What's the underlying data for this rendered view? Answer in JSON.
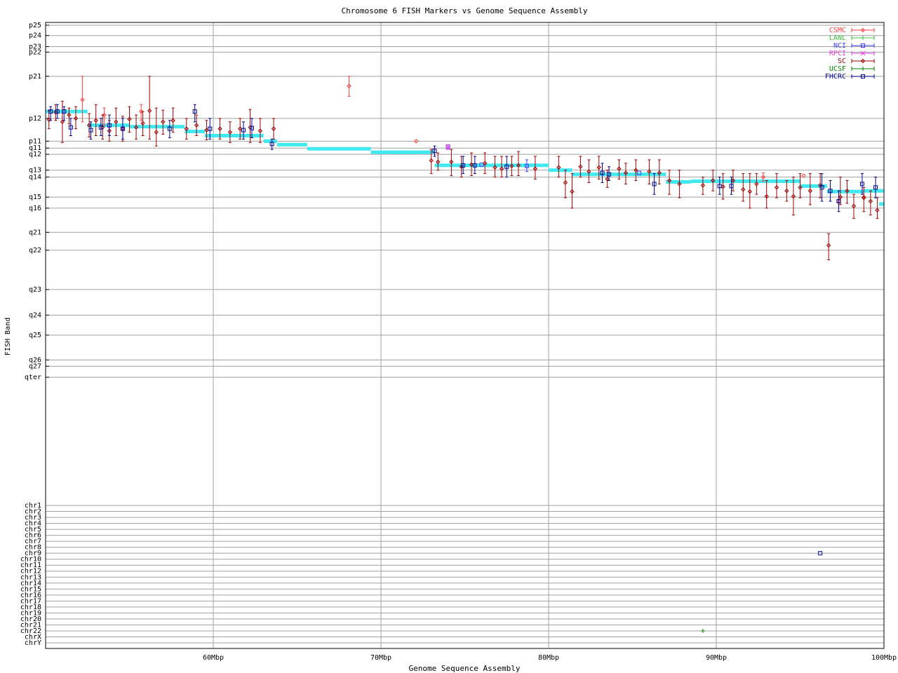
{
  "chart_data": {
    "type": "scatter",
    "title": "Chromosome 6 FISH Markers vs Genome Sequence Assembly",
    "xlabel": "Genome Sequence Assembly",
    "ylabel": "FISH Band",
    "xlim": [
      50,
      100
    ],
    "x_unit": "Mbp",
    "x_ticks": [
      60,
      70,
      80,
      90,
      100
    ],
    "x_tick_labels": [
      "60Mbp",
      "70Mbp",
      "80Mbp",
      "90Mbp",
      "100Mbp"
    ],
    "grid": true,
    "legend_position": "top-right",
    "band_axis": [
      {
        "label": "p25",
        "v": 0
      },
      {
        "label": "p24",
        "v": 1.5
      },
      {
        "label": "p23",
        "v": 3.1
      },
      {
        "label": "p22",
        "v": 3.9
      },
      {
        "label": "p21",
        "v": 7.4
      },
      {
        "label": "p12",
        "v": 13.5
      },
      {
        "label": "p11",
        "v": 16.8
      },
      {
        "label": "q11",
        "v": 17.8
      },
      {
        "label": "q12",
        "v": 18.7
      },
      {
        "label": "q13",
        "v": 21.0
      },
      {
        "label": "q14",
        "v": 22.0
      },
      {
        "label": "q15",
        "v": 24.9
      },
      {
        "label": "q16",
        "v": 26.5
      },
      {
        "label": "q21",
        "v": 30.0
      },
      {
        "label": "q22",
        "v": 32.6
      },
      {
        "label": "q23",
        "v": 38.3
      },
      {
        "label": "q24",
        "v": 42.0
      },
      {
        "label": "q25",
        "v": 44.9
      },
      {
        "label": "q26",
        "v": 48.5
      },
      {
        "label": "q27",
        "v": 49.4
      },
      {
        "label": "qter",
        "v": 51.0
      }
    ],
    "band_range": [
      -0.2,
      51.6
    ],
    "chromosome_axis": [
      "chr1",
      "chr2",
      "chr3",
      "chr4",
      "chr5",
      "chr6",
      "chr7",
      "chr8",
      "chr9",
      "chr10",
      "chr11",
      "chr12",
      "chr13",
      "chr14",
      "chr15",
      "chr16",
      "chr17",
      "chr18",
      "chr19",
      "chr20",
      "chr21",
      "chr22",
      "chrX",
      "chrY"
    ],
    "series": [
      {
        "name": "CSMC",
        "color": "#ff4040",
        "marker": "diamond",
        "points": [
          {
            "x": 52.2,
            "y": 10.8,
            "lo": 7.4,
            "hi": 14.0
          },
          {
            "x": 53.5,
            "y": 13.0,
            "lo": 12.0,
            "hi": 14.5
          },
          {
            "x": 55.7,
            "y": 12.5,
            "lo": 11.5,
            "hi": 13.8
          },
          {
            "x": 68.1,
            "y": 8.8,
            "lo": 7.4,
            "hi": 10.3
          },
          {
            "x": 72.1,
            "y": 16.8
          },
          {
            "x": 92.8,
            "y": 22.0,
            "lo": 21.4,
            "hi": 22.6
          },
          {
            "x": 95.2,
            "y": 21.8
          },
          {
            "x": 97.3,
            "y": 25.5
          },
          {
            "x": 98.8,
            "y": 24.9
          }
        ]
      },
      {
        "name": "LANL",
        "color": "#40c040",
        "marker": "plus",
        "points": []
      },
      {
        "name": "NCI",
        "color": "#4040ff",
        "marker": "square",
        "points": [
          {
            "x": 74.0,
            "y": 17.6
          },
          {
            "x": 76.0,
            "y": 20.2
          },
          {
            "x": 78.7,
            "y": 20.4,
            "lo": 19.5,
            "hi": 21.2
          },
          {
            "x": 85.4,
            "y": 21.4
          }
        ]
      },
      {
        "name": "RPCI",
        "color": "#e040e0",
        "marker": "cross",
        "points": [
          {
            "x": 74.0,
            "y": 17.7,
            "lo": 17.3,
            "hi": 18.0
          }
        ]
      },
      {
        "name": "SC",
        "color": "#a00000",
        "marker": "diamond",
        "points": [
          {
            "x": 50.2,
            "y": 13.7,
            "lo": 12.4,
            "hi": 15.0
          },
          {
            "x": 50.6,
            "y": 12.6,
            "lo": 11.5,
            "hi": 13.8
          },
          {
            "x": 51.0,
            "y": 14.0,
            "lo": 11.0,
            "hi": 17.0
          },
          {
            "x": 51.4,
            "y": 13.0,
            "lo": 12.0,
            "hi": 14.3
          },
          {
            "x": 51.8,
            "y": 13.5,
            "lo": 11.8,
            "hi": 15.0
          },
          {
            "x": 52.6,
            "y": 14.5,
            "lo": 12.8,
            "hi": 16.2
          },
          {
            "x": 53.0,
            "y": 13.8,
            "lo": 11.5,
            "hi": 16.0
          },
          {
            "x": 53.4,
            "y": 14.8,
            "lo": 13.0,
            "hi": 16.5
          },
          {
            "x": 53.8,
            "y": 15.3,
            "lo": 13.8,
            "hi": 16.8
          },
          {
            "x": 54.2,
            "y": 14.0,
            "lo": 12.0,
            "hi": 16.0
          },
          {
            "x": 54.6,
            "y": 15.0,
            "lo": 13.2,
            "hi": 16.8
          },
          {
            "x": 55.0,
            "y": 13.6,
            "lo": 11.8,
            "hi": 15.5
          },
          {
            "x": 55.4,
            "y": 14.8,
            "lo": 13.0,
            "hi": 16.5
          },
          {
            "x": 55.8,
            "y": 14.2,
            "lo": 12.5,
            "hi": 16.0
          },
          {
            "x": 56.2,
            "y": 12.4,
            "lo": 7.4,
            "hi": 16.5
          },
          {
            "x": 56.6,
            "y": 15.5,
            "lo": 12.0,
            "hi": 17.5
          },
          {
            "x": 57.0,
            "y": 14.0,
            "lo": 12.3,
            "hi": 15.8
          },
          {
            "x": 57.6,
            "y": 13.8,
            "lo": 12.0,
            "hi": 15.5
          },
          {
            "x": 58.4,
            "y": 15.0,
            "lo": 13.5,
            "hi": 16.5
          },
          {
            "x": 59.0,
            "y": 14.5,
            "lo": 13.0,
            "hi": 16.0
          },
          {
            "x": 59.6,
            "y": 15.2,
            "lo": 13.8,
            "hi": 16.6
          },
          {
            "x": 60.4,
            "y": 15.0,
            "lo": 13.5,
            "hi": 16.5
          },
          {
            "x": 61.0,
            "y": 15.5,
            "lo": 14.0,
            "hi": 17.0
          },
          {
            "x": 61.6,
            "y": 15.0,
            "lo": 13.5,
            "hi": 16.5
          },
          {
            "x": 62.2,
            "y": 14.8,
            "lo": 12.2,
            "hi": 17.0
          },
          {
            "x": 62.8,
            "y": 15.3,
            "lo": 13.5,
            "hi": 17.0
          },
          {
            "x": 63.6,
            "y": 15.0,
            "lo": 13.5,
            "hi": 16.5
          },
          {
            "x": 73.0,
            "y": 19.6,
            "lo": 18.0,
            "hi": 21.5
          },
          {
            "x": 73.4,
            "y": 19.8,
            "lo": 18.5,
            "hi": 21.0
          },
          {
            "x": 74.2,
            "y": 19.8,
            "lo": 18.0,
            "hi": 21.8
          },
          {
            "x": 74.8,
            "y": 20.5,
            "lo": 19.0,
            "hi": 22.0
          },
          {
            "x": 75.4,
            "y": 20.2,
            "lo": 18.5,
            "hi": 21.8
          },
          {
            "x": 76.2,
            "y": 20.0,
            "lo": 18.5,
            "hi": 21.5
          },
          {
            "x": 76.8,
            "y": 20.6,
            "lo": 19.0,
            "hi": 22.0
          },
          {
            "x": 77.2,
            "y": 20.8,
            "lo": 19.0,
            "hi": 22.0
          },
          {
            "x": 77.8,
            "y": 20.4,
            "lo": 19.0,
            "hi": 21.8
          },
          {
            "x": 78.2,
            "y": 20.3,
            "lo": 18.3,
            "hi": 21.8
          },
          {
            "x": 79.2,
            "y": 20.8,
            "lo": 19.0,
            "hi": 22.3
          },
          {
            "x": 80.6,
            "y": 20.6,
            "lo": 19.0,
            "hi": 22.0
          },
          {
            "x": 81.0,
            "y": 22.8,
            "lo": 21.0,
            "hi": 25.0
          },
          {
            "x": 81.4,
            "y": 24.1,
            "lo": 21.5,
            "hi": 26.5
          },
          {
            "x": 81.9,
            "y": 20.5,
            "lo": 19.0,
            "hi": 22.0
          },
          {
            "x": 82.4,
            "y": 21.2,
            "lo": 19.5,
            "hi": 22.8
          },
          {
            "x": 83.0,
            "y": 20.6,
            "lo": 19.0,
            "hi": 22.3
          },
          {
            "x": 83.5,
            "y": 22.3,
            "lo": 21.0,
            "hi": 23.5
          },
          {
            "x": 84.2,
            "y": 20.8,
            "lo": 19.5,
            "hi": 22.3
          },
          {
            "x": 84.6,
            "y": 21.4,
            "lo": 20.0,
            "hi": 23.0
          },
          {
            "x": 85.2,
            "y": 21.0,
            "lo": 19.5,
            "hi": 22.5
          },
          {
            "x": 86.0,
            "y": 21.2,
            "lo": 19.5,
            "hi": 23.0
          },
          {
            "x": 86.6,
            "y": 21.4,
            "lo": 19.5,
            "hi": 23.0
          },
          {
            "x": 87.2,
            "y": 22.5,
            "lo": 21.0,
            "hi": 24.5
          },
          {
            "x": 87.8,
            "y": 23.0,
            "lo": 21.0,
            "hi": 25.0
          },
          {
            "x": 89.2,
            "y": 23.2,
            "lo": 22.0,
            "hi": 24.5
          },
          {
            "x": 89.8,
            "y": 22.5,
            "lo": 21.0,
            "hi": 24.0
          },
          {
            "x": 90.4,
            "y": 23.4,
            "lo": 21.5,
            "hi": 25.2
          },
          {
            "x": 91.0,
            "y": 22.5,
            "lo": 21.0,
            "hi": 24.0
          },
          {
            "x": 91.6,
            "y": 23.8,
            "lo": 21.5,
            "hi": 25.5
          },
          {
            "x": 92.0,
            "y": 24.1,
            "lo": 21.5,
            "hi": 26.5
          },
          {
            "x": 92.4,
            "y": 23.0,
            "lo": 21.5,
            "hi": 24.5
          },
          {
            "x": 93.0,
            "y": 24.8,
            "lo": 22.5,
            "hi": 26.5
          },
          {
            "x": 93.6,
            "y": 23.5,
            "lo": 21.5,
            "hi": 25.0
          },
          {
            "x": 94.2,
            "y": 24.0,
            "lo": 22.5,
            "hi": 25.5
          },
          {
            "x": 94.6,
            "y": 24.8,
            "lo": 22.0,
            "hi": 27.5
          },
          {
            "x": 95.0,
            "y": 23.5,
            "lo": 21.5,
            "hi": 25.0
          },
          {
            "x": 95.6,
            "y": 24.0,
            "lo": 21.5,
            "hi": 26.0
          },
          {
            "x": 96.2,
            "y": 23.2,
            "lo": 21.5,
            "hi": 25.0
          },
          {
            "x": 96.7,
            "y": 31.9,
            "lo": 30.2,
            "hi": 34.0
          },
          {
            "x": 97.4,
            "y": 24.9,
            "lo": 22.0,
            "hi": 26.0
          },
          {
            "x": 97.8,
            "y": 24.0,
            "lo": 22.5,
            "hi": 25.8
          },
          {
            "x": 98.2,
            "y": 26.2,
            "lo": 24.5,
            "hi": 28.0
          },
          {
            "x": 98.8,
            "y": 25.0,
            "lo": 23.5,
            "hi": 27.0
          },
          {
            "x": 99.2,
            "y": 25.5,
            "lo": 24.0,
            "hi": 27.5
          },
          {
            "x": 99.6,
            "y": 26.8,
            "lo": 25.0,
            "hi": 28.0
          }
        ]
      },
      {
        "name": "UCSF",
        "color": "#008000",
        "marker": "plus",
        "points": [
          {
            "x": 89.2,
            "y": "chr22"
          }
        ]
      },
      {
        "name": "FHCRC",
        "color": "#000090",
        "marker": "square",
        "points": [
          {
            "x": 50.3,
            "y": 12.5,
            "lo": 11.8,
            "hi": 13.8
          },
          {
            "x": 50.7,
            "y": 12.5,
            "lo": 11.5,
            "hi": 13.5
          },
          {
            "x": 51.1,
            "y": 12.5,
            "lo": 11.8,
            "hi": 13.8
          },
          {
            "x": 51.5,
            "y": 14.8,
            "lo": 13.5,
            "hi": 16.0
          },
          {
            "x": 52.7,
            "y": 15.2,
            "lo": 14.0,
            "hi": 16.5
          },
          {
            "x": 53.3,
            "y": 14.8,
            "lo": 13.5,
            "hi": 16.0
          },
          {
            "x": 53.8,
            "y": 14.5,
            "lo": 13.0,
            "hi": 16.0
          },
          {
            "x": 54.6,
            "y": 15.0,
            "lo": 13.5,
            "hi": 16.5
          },
          {
            "x": 57.4,
            "y": 15.0,
            "lo": 13.8,
            "hi": 16.3
          },
          {
            "x": 58.9,
            "y": 12.5,
            "lo": 11.5,
            "hi": 14.0
          },
          {
            "x": 59.8,
            "y": 15.0,
            "lo": 13.5,
            "hi": 16.5
          },
          {
            "x": 61.8,
            "y": 15.2,
            "lo": 14.0,
            "hi": 16.5
          },
          {
            "x": 62.3,
            "y": 14.9,
            "lo": 13.5,
            "hi": 16.3
          },
          {
            "x": 63.5,
            "y": 17.2,
            "lo": 16.5,
            "hi": 18.0
          },
          {
            "x": 73.2,
            "y": 18.2,
            "lo": 17.5,
            "hi": 19.0
          },
          {
            "x": 74.9,
            "y": 20.3,
            "lo": 19.0,
            "hi": 21.5
          },
          {
            "x": 75.6,
            "y": 20.3,
            "lo": 19.0,
            "hi": 21.5
          },
          {
            "x": 77.5,
            "y": 20.5,
            "lo": 19.0,
            "hi": 22.0
          },
          {
            "x": 83.2,
            "y": 21.4,
            "lo": 20.0,
            "hi": 22.8
          },
          {
            "x": 83.6,
            "y": 21.6,
            "lo": 20.5,
            "hi": 22.5
          },
          {
            "x": 86.3,
            "y": 23.0,
            "lo": 21.5,
            "hi": 24.5
          },
          {
            "x": 90.2,
            "y": 23.3,
            "lo": 22.0,
            "hi": 24.5
          },
          {
            "x": 90.9,
            "y": 23.3,
            "lo": 22.0,
            "hi": 24.5
          },
          {
            "x": 96.3,
            "y": 23.5,
            "lo": 21.5,
            "hi": 25.5
          },
          {
            "x": 96.8,
            "y": 24.0,
            "lo": 22.5,
            "hi": 25.5
          },
          {
            "x": 97.3,
            "y": 25.5,
            "lo": 24.0,
            "hi": 27.0
          },
          {
            "x": 98.7,
            "y": 23.0,
            "lo": 21.5,
            "hi": 24.5
          },
          {
            "x": 99.5,
            "y": 23.5,
            "lo": 22.0,
            "hi": 25.0
          },
          {
            "x": 96.2,
            "y": "chr9"
          }
        ]
      }
    ],
    "assembly_track": {
      "color": "#40e8f0",
      "segments": [
        {
          "x0": 50.0,
          "x1": 52.5,
          "y": 12.5
        },
        {
          "x0": 52.5,
          "x1": 55.0,
          "y": 14.5
        },
        {
          "x0": 55.0,
          "x1": 58.3,
          "y": 14.7
        },
        {
          "x0": 58.3,
          "x1": 59.5,
          "y": 15.4
        },
        {
          "x0": 59.5,
          "x1": 61.0,
          "y": 16.0
        },
        {
          "x0": 61.0,
          "x1": 63.0,
          "y": 16.0
        },
        {
          "x0": 63.0,
          "x1": 63.8,
          "y": 16.8
        },
        {
          "x0": 63.8,
          "x1": 65.6,
          "y": 17.3
        },
        {
          "x0": 65.6,
          "x1": 69.4,
          "y": 17.9
        },
        {
          "x0": 69.4,
          "x1": 73.2,
          "y": 18.4
        },
        {
          "x0": 73.2,
          "x1": 77.6,
          "y": 20.3
        },
        {
          "x0": 77.6,
          "x1": 80.0,
          "y": 20.3
        },
        {
          "x0": 80.0,
          "x1": 81.4,
          "y": 21.0
        },
        {
          "x0": 81.4,
          "x1": 87.0,
          "y": 21.6
        },
        {
          "x0": 87.0,
          "x1": 88.5,
          "y": 22.7
        },
        {
          "x0": 88.5,
          "x1": 95.0,
          "y": 22.6
        },
        {
          "x0": 95.0,
          "x1": 96.6,
          "y": 23.3
        },
        {
          "x0": 96.6,
          "x1": 98.8,
          "y": 24.1
        },
        {
          "x0": 98.8,
          "x1": 100.0,
          "y": 24.0
        },
        {
          "x0": 99.7,
          "x1": 100.0,
          "y": 25.9
        }
      ]
    }
  }
}
